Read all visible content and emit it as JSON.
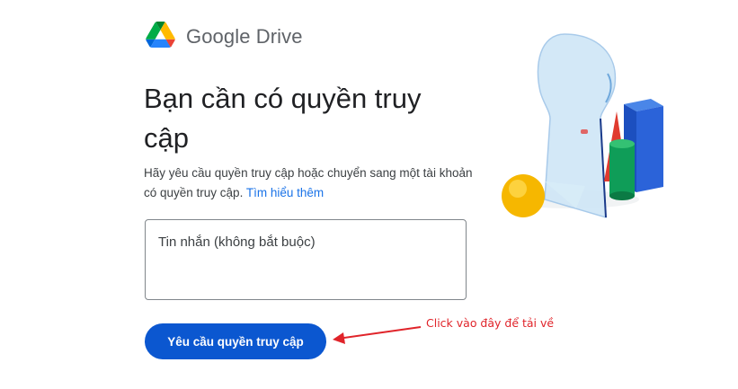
{
  "header": {
    "brand_name": "Google Drive",
    "logo_icon": "google-drive-logo"
  },
  "main": {
    "title": "Bạn cần có quyền truy cập",
    "description": "Hãy yêu cầu quyền truy cập hoặc chuyển sang một tài khoản có quyền truy cập.",
    "learn_more_link": "Tìm hiểu thêm",
    "message_placeholder": "Tin nhắn (không bắt buộc)",
    "message_value": "",
    "request_button_label": "Yêu cầu quyền truy cập"
  },
  "annotation": {
    "text": "Click vào đây để tải về",
    "color": "#e0242a"
  },
  "colors": {
    "primary_button": "#0b57d0",
    "link": "#1a73e8",
    "title_text": "#202124",
    "brand_text": "#5f6368"
  }
}
